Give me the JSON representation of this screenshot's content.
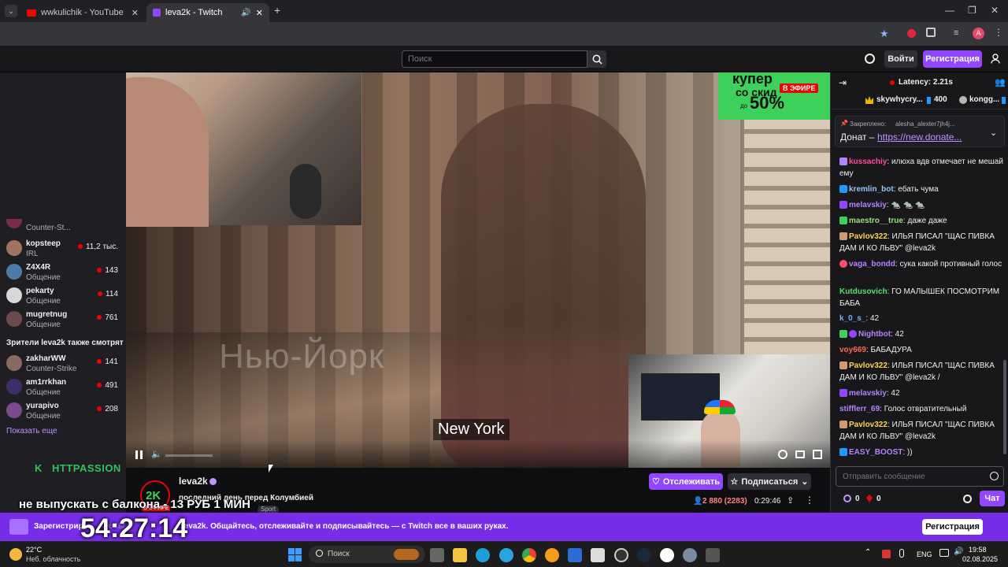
{
  "browser": {
    "tabs": [
      {
        "title": "wwkulichik - YouTube",
        "icon": "youtube-icon",
        "active": false
      },
      {
        "title": "leva2k - Twitch",
        "icon": "twitch-icon",
        "active": true
      }
    ],
    "new_tab_label": "+",
    "profile_initial": "A"
  },
  "topnav": {
    "search_placeholder": "Поиск",
    "login_label": "Войти",
    "signup_label": "Регистрация"
  },
  "sidebar": {
    "top_item": {
      "category": "Counter-St..."
    },
    "followed": [
      {
        "name": "kopsteep",
        "category": "IRL",
        "viewers": "11,2 тыс."
      },
      {
        "name": "Z4X4R",
        "category": "Общение",
        "viewers": "143"
      },
      {
        "name": "pekarty",
        "category": "Общение",
        "viewers": "114"
      },
      {
        "name": "mugretnug",
        "category": "Общение",
        "viewers": "761"
      }
    ],
    "also_watch_heading": "Зрители leva2k также смотрят",
    "also_watch": [
      {
        "name": "zakharWW",
        "category": "Counter-Strike",
        "viewers": "141"
      },
      {
        "name": "am1rrkhan",
        "category": "Общение",
        "viewers": "491"
      },
      {
        "name": "yurapivo",
        "category": "Общение",
        "viewers": "208"
      }
    ],
    "show_more": "Показать еще",
    "overlay_brand": "HTTPASSION",
    "overlay_brand_letter": "K"
  },
  "player": {
    "ad_text_1": "купер",
    "ad_text_2": "со скид",
    "ad_text_3": "до",
    "ad_percent": "50%",
    "live_badge": "В ЭФИРЕ",
    "watermark": "Нью-Йорк",
    "subtitle": "New York"
  },
  "stream_info": {
    "streamer": "leva2k",
    "title": "последний день перед Колумбией",
    "tag": "Sport",
    "follow_label": "Отслеживать",
    "subscribe_label": "Подписаться",
    "viewers": "2 880 (2283)",
    "uptime": "0:29:46",
    "overlay_line1": "не выпускать с балкона - 13 РУБ 1 МИН",
    "overlay_timer": "54:27:14",
    "avatar_text": "2K",
    "avatar_live": "В ЭФИРЕ"
  },
  "chat": {
    "latency": "Latency: 2.21s",
    "leaderboard": [
      {
        "name": "skywhycry...",
        "score": "400"
      },
      {
        "name": "kongg...",
        "score": ""
      }
    ],
    "pinned_by_label": "Закреплено:",
    "pinned_by": "alesha_alexter7jh4j...",
    "pinned_text": "Донат – ",
    "pinned_link": "https://new.donate...",
    "messages": [
      {
        "user": "kussachiy",
        "color": "#ff4aa0",
        "text": "илюха вдв отмечает не мешай ему"
      },
      {
        "user": "kremlin_bot",
        "color": "#8ec5ff",
        "text": "ебать чума"
      },
      {
        "user": "melavskiy",
        "color": "#b583ff",
        "text": "🐀 🐀 🐀"
      },
      {
        "user": "maestro__true",
        "color": "#9ae07a",
        "text": "даже даже"
      },
      {
        "user": "Pavlov322",
        "color": "#ffd34d",
        "text": "ИЛЬЯ ПИСАЛ \"ЩАС ПИВКА ДАМ И КО ЛЬВУ\" @leva2k"
      },
      {
        "user": "vaga_bondd",
        "color": "#b583ff",
        "text": "сука какой противный голос"
      },
      {
        "user": "Kutdusovich",
        "color": "#58e06a",
        "text": "ГО МАЛЫШЕК ПОСМОТРИМ БАБА"
      },
      {
        "user": "k_0_s_",
        "color": "#6fb3ff",
        "text": "42"
      },
      {
        "user": "Nightbot",
        "color": "#b583ff",
        "text": "42"
      },
      {
        "user": "voy669",
        "color": "#ff6a4d",
        "text": "БАБАДУРА"
      },
      {
        "user": "Pavlov322",
        "color": "#ffd34d",
        "text": "ИЛЬЯ ПИСАЛ \"ЩАС ПИВКА ДАМ И КО ЛЬВУ\" @leva2k /"
      },
      {
        "user": "melavskiy",
        "color": "#b583ff",
        "text": "42"
      },
      {
        "user": "stifflerr_69",
        "color": "#b583ff",
        "text": "Голос отвратительный"
      },
      {
        "user": "Pavlov322",
        "color": "#ffd34d",
        "text": "ИЛЬЯ ПИСАЛ \"ЩАС ПИВКА ДАМ И КО ЛЬВУ\" @leva2k"
      },
      {
        "user": "EASY_BOOST",
        "color": "#b583ff",
        "text": "))"
      }
    ],
    "input_placeholder": "Отправить сообщение",
    "points": "0",
    "bits": "0",
    "send_label": "Чат"
  },
  "banner": {
    "text_prefix": "Зарегистрир",
    "text_mid": "чтобы с",
    "text_suffix": "leva2k. Общайтесь, отслеживайте и подписывайтесь — с Twitch все в ваших руках.",
    "button": "Регистрация"
  },
  "taskbar": {
    "temp": "22°C",
    "weather": "Неб. облачность",
    "search": "Поиск",
    "lang": "ENG",
    "time": "19:58",
    "date": "02.08.2025"
  },
  "colors": {
    "twitch_purple": "#9147ff",
    "live_red": "#eb0400",
    "banner": "#772ce8"
  }
}
